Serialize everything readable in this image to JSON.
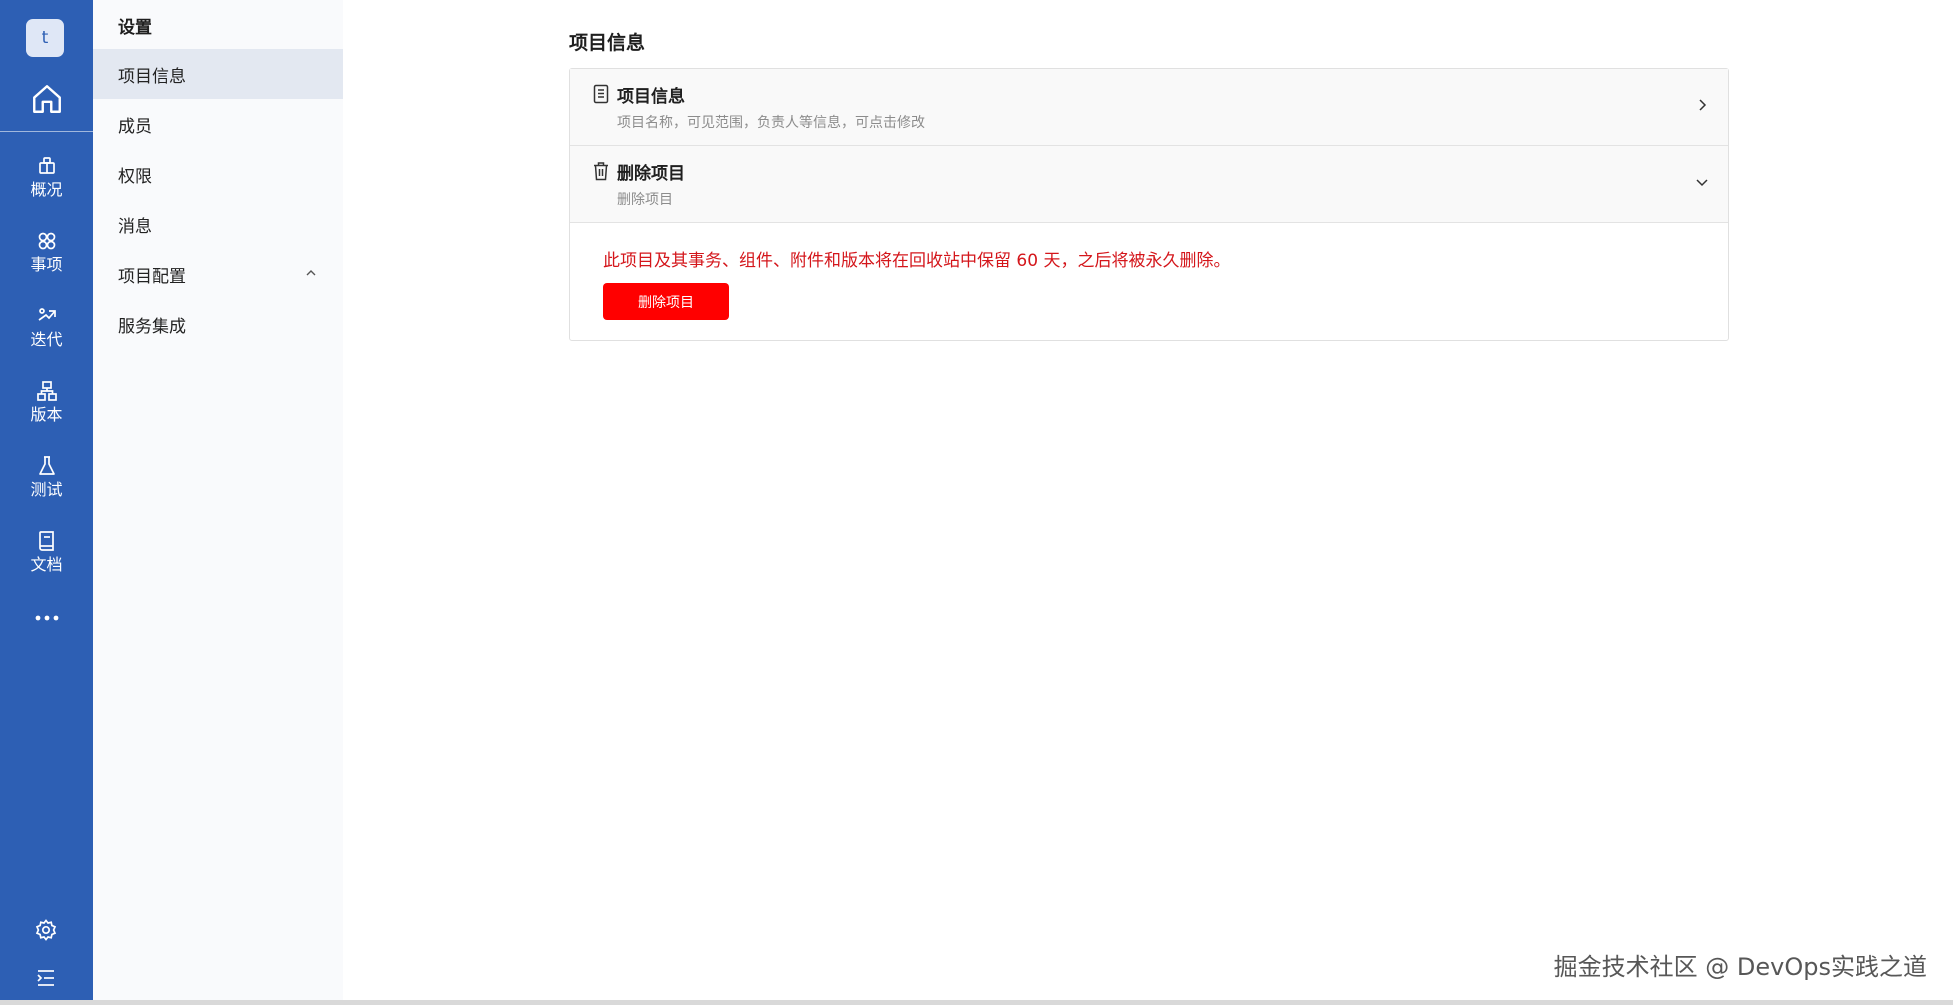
{
  "rail": {
    "avatar": "t",
    "items": [
      {
        "label": "概况",
        "icon": "overview-icon"
      },
      {
        "label": "事项",
        "icon": "workitem-icon"
      },
      {
        "label": "迭代",
        "icon": "sprint-icon"
      },
      {
        "label": "版本",
        "icon": "version-icon"
      },
      {
        "label": "测试",
        "icon": "test-icon"
      },
      {
        "label": "文档",
        "icon": "doc-icon"
      }
    ]
  },
  "sidebar": {
    "title": "设置",
    "items": [
      {
        "label": "项目信息"
      },
      {
        "label": "成员"
      },
      {
        "label": "权限"
      },
      {
        "label": "消息"
      },
      {
        "label": "项目配置"
      },
      {
        "label": "服务集成"
      }
    ]
  },
  "main": {
    "title": "项目信息",
    "info_row": {
      "title": "项目信息",
      "desc": "项目名称，可见范围，负责人等信息，可点击修改"
    },
    "delete_row": {
      "title": "删除项目",
      "desc": "删除项目"
    },
    "warning": "此项目及其事务、组件、附件和版本将在回收站中保留 60 天，之后将被永久删除。",
    "delete_button": "删除项目"
  },
  "watermark": "掘金技术社区 @ DevOps实践之道",
  "colors": {
    "rail": "#2d5fb4",
    "danger": "#ff0000",
    "warning_text": "#d4161b"
  }
}
